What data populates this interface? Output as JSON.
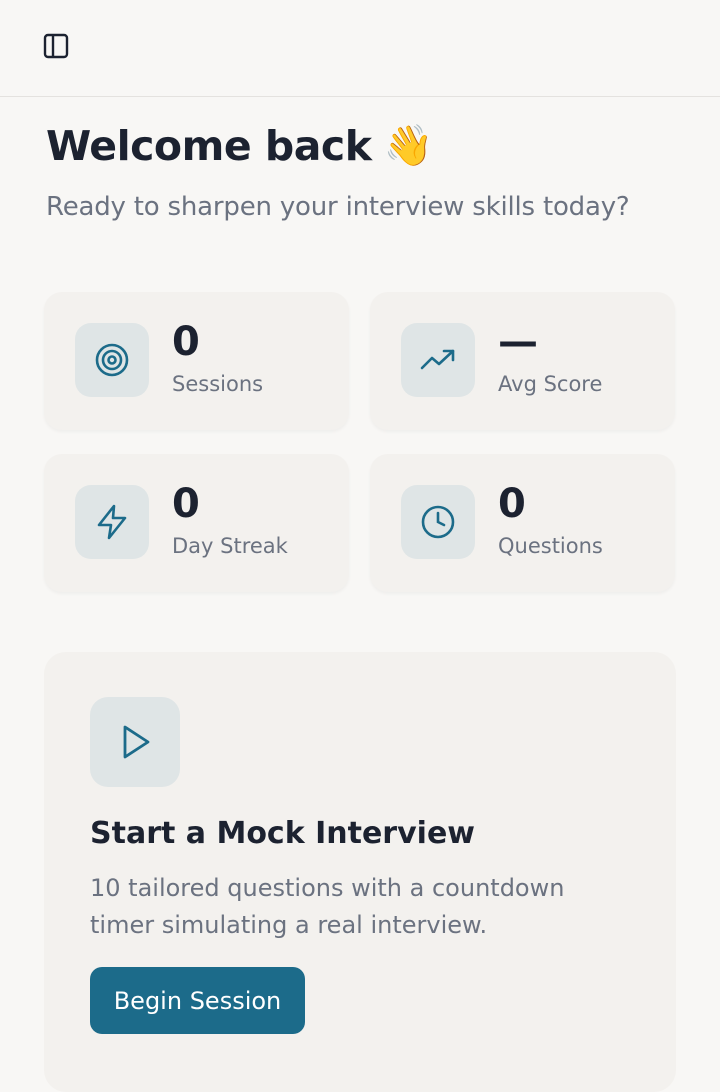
{
  "header": {
    "toggle_icon": "sidebar-toggle-icon"
  },
  "welcome": {
    "title": "Welcome back",
    "emoji": "👋",
    "subtitle": "Ready to sharpen your interview skills today?"
  },
  "stats": [
    {
      "icon": "target-icon",
      "value": "0",
      "label": "Sessions"
    },
    {
      "icon": "trending-up-icon",
      "value": "—",
      "label": "Avg Score"
    },
    {
      "icon": "lightning-icon",
      "value": "0",
      "label": "Day Streak"
    },
    {
      "icon": "clock-icon",
      "value": "0",
      "label": "Questions"
    }
  ],
  "cta": {
    "icon": "play-icon",
    "title": "Start a Mock Interview",
    "description": "10 tailored questions with a countdown timer simulating a real interview.",
    "button_label": "Begin Session"
  },
  "colors": {
    "accent": "#1c6b8a",
    "icon_bg": "#dfe5e6",
    "card_bg": "#f3f1ee",
    "text_primary": "#1c2230",
    "text_muted": "#6b7280"
  }
}
